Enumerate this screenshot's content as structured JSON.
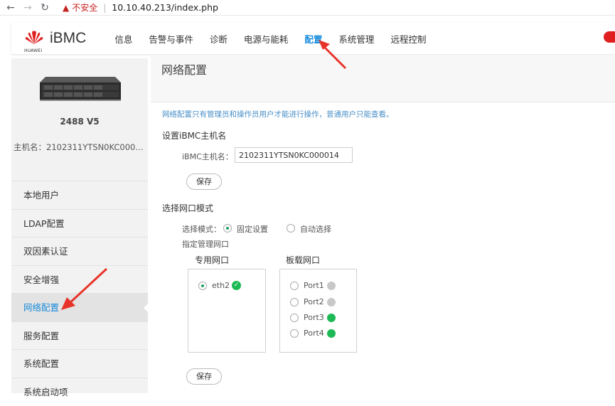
{
  "browser": {
    "insecure_label": "不安全",
    "url": "10.10.40.213/index.php"
  },
  "header": {
    "brand_small": "HUAWEI",
    "title": "iBMC",
    "menu": [
      "信息",
      "告警与事件",
      "诊断",
      "电源与能耗",
      "配置",
      "系统管理",
      "远程控制"
    ],
    "active_menu": "配置"
  },
  "sidebar": {
    "model": "2488 V5",
    "hostname": "主机名：2102311YTSN0KC0000...",
    "items": [
      "本地用户",
      "LDAP配置",
      "双因素认证",
      "安全增强",
      "网络配置",
      "服务配置",
      "系统配置",
      "系统启动项"
    ],
    "active_item": "网络配置"
  },
  "main": {
    "title": "网络配置",
    "notice": "网络配置只有管理员和操作员用户才能进行操作，普通用户只能查看。",
    "hostname_section": {
      "title": "设置iBMC主机名",
      "label": "iBMC主机名：",
      "value": "2102311YTSN0KC000014",
      "save": "保存"
    },
    "port_section": {
      "title": "选择网口模式",
      "mode_label": "选择模式：",
      "mode_fixed": "固定设置",
      "mode_auto": "自动选择",
      "selected_mode": "固定设置",
      "assign_label": "指定管理网口",
      "dedicated_title": "专用网口",
      "dedicated_ports": [
        {
          "name": "eth2",
          "checked": true,
          "status": "ok"
        }
      ],
      "onboard_title": "板载网口",
      "onboard_ports": [
        {
          "name": "Port1",
          "status": "gray"
        },
        {
          "name": "Port2",
          "status": "gray"
        },
        {
          "name": "Port3",
          "status": "green"
        },
        {
          "name": "Port4",
          "status": "green"
        }
      ],
      "save": "保存"
    }
  },
  "colors": {
    "accent": "#1a8cdc",
    "link_ok": "#1db954",
    "annotation": "#e8332a"
  }
}
